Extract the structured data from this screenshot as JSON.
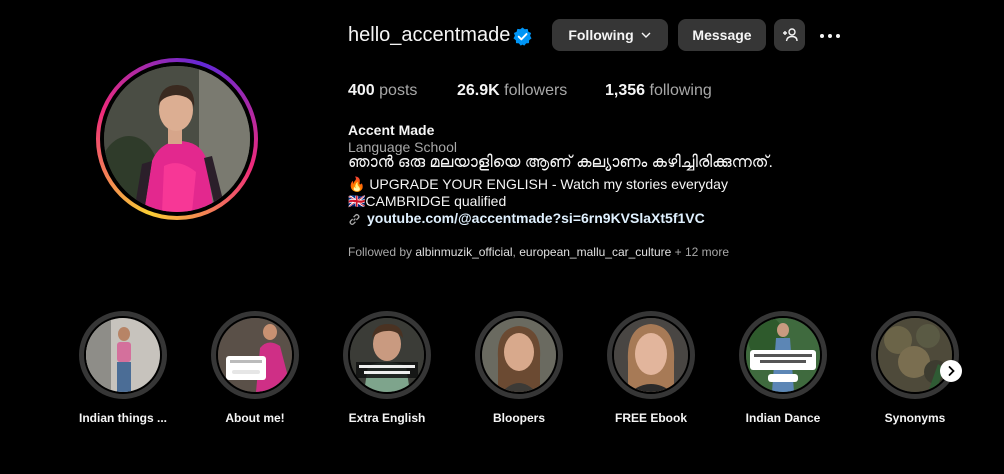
{
  "profile": {
    "username": "hello_accentmade",
    "stats": {
      "posts_count": "400",
      "posts_label": "posts",
      "followers_count": "26.9K",
      "followers_label": "followers",
      "following_count": "1,356",
      "following_label": "following"
    },
    "bio": {
      "name": "Accent Made",
      "category": "Language School",
      "line_malayalam": "ഞാൻ ഒരു മലയാളിയെ ആണ് കല്യാണം കഴിച്ചിരിക്കുന്നത്.",
      "line_upgrade": "🔥 UPGRADE YOUR ENGLISH - Watch my stories everyday",
      "line_cambridge": "🇬🇧CAMBRIDGE qualified",
      "link": "youtube.com/@accentmade?si=6rn9KVSlaXt5f1VC"
    },
    "followed_by": {
      "prefix": "Followed by ",
      "user1": "albinmuzik_official",
      "sep": ", ",
      "user2": "european_mallu_car_culture",
      "suffix": " + 12 more"
    }
  },
  "actions": {
    "following_label": "Following",
    "message_label": "Message"
  },
  "highlights": [
    {
      "label": "Indian things ..."
    },
    {
      "label": "About me!"
    },
    {
      "label": "Extra English"
    },
    {
      "label": "Bloopers"
    },
    {
      "label": "FREE Ebook"
    },
    {
      "label": "Indian Dance"
    },
    {
      "label": "Synonyms"
    }
  ],
  "colors": {
    "background": "#000000",
    "button": "#363636",
    "verified": "#0095f6",
    "link": "#e0f1ff",
    "muted_text": "#a8a8a8"
  },
  "icons": [
    "verified-badge-icon",
    "chevron-down-icon",
    "add-user-icon",
    "more-options-icon",
    "link-icon",
    "chevron-right-icon"
  ]
}
